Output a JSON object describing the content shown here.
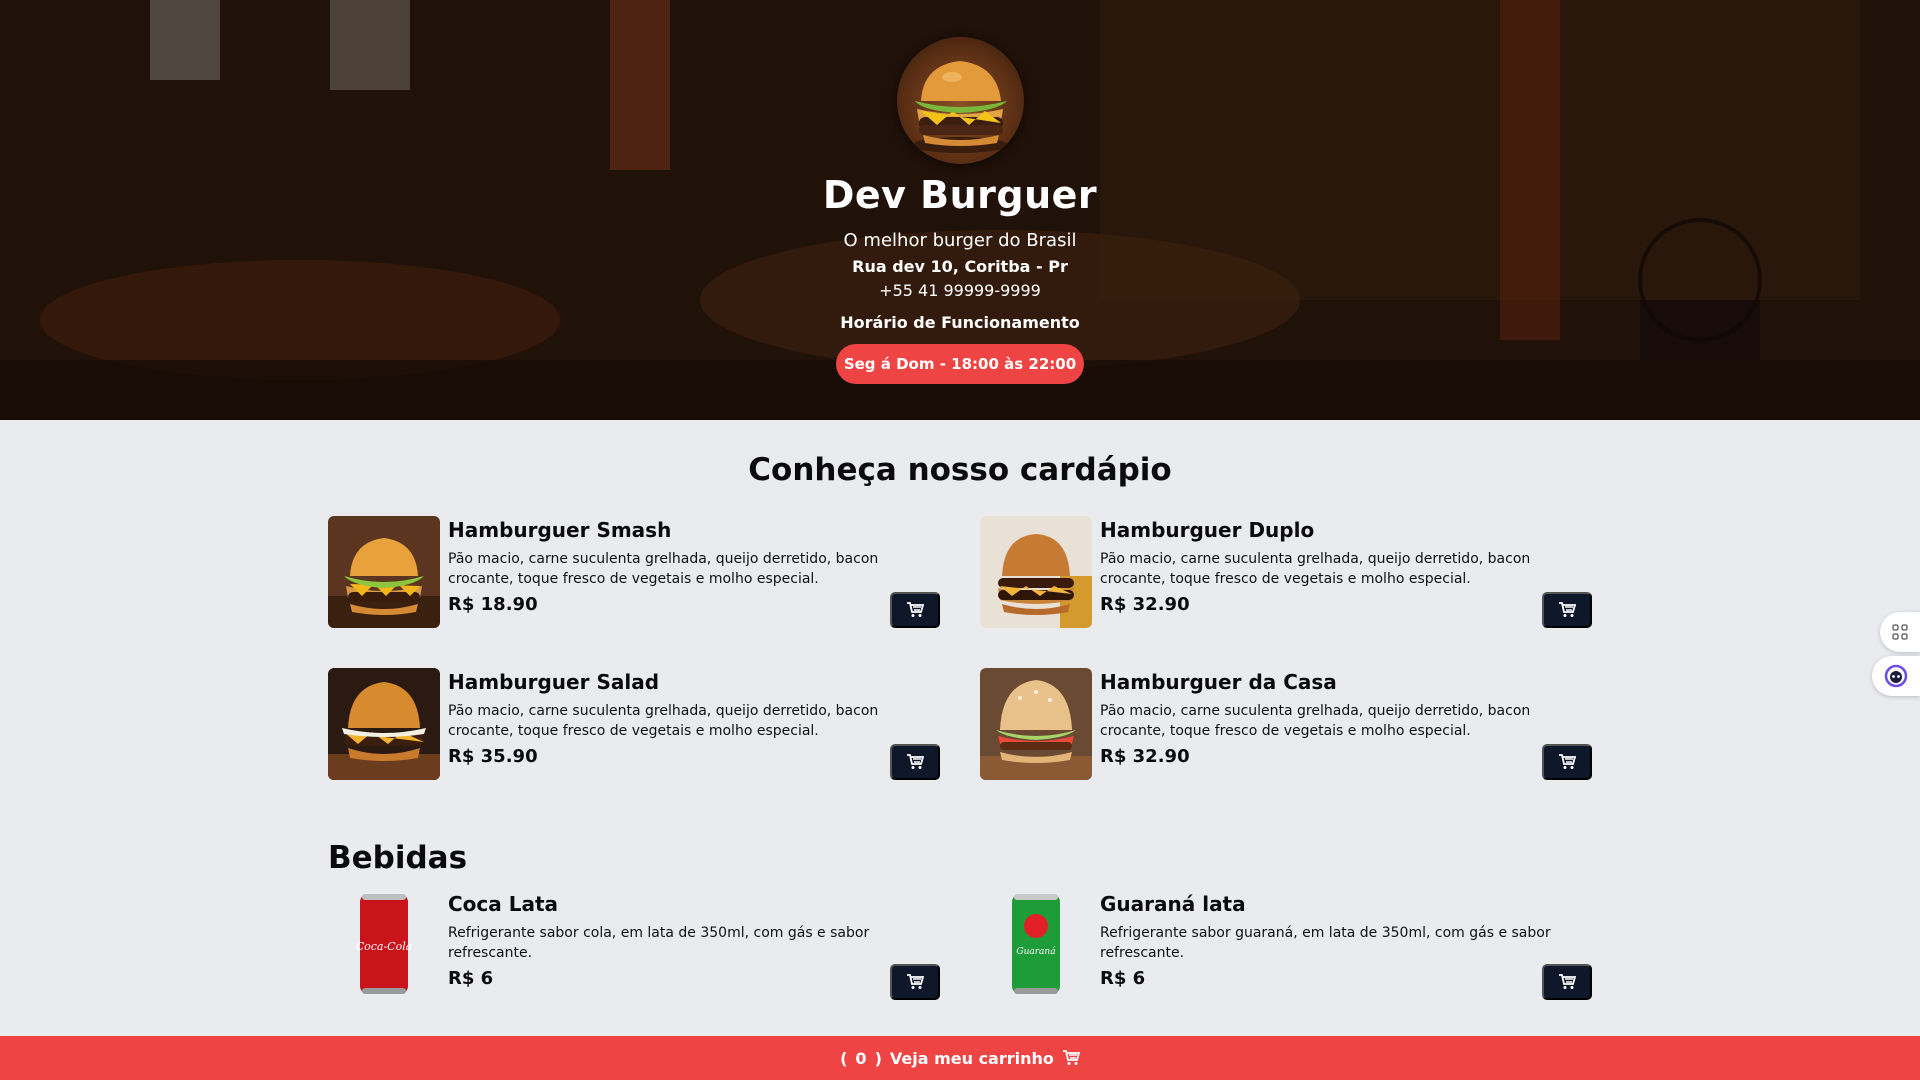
{
  "hero": {
    "title": "Dev Burguer",
    "tagline": "O melhor burger do Brasil",
    "address": "Rua dev 10, Coritba - Pr",
    "phone": "+55 41 99999-9999",
    "hours_title": "Horário de Funcionamento",
    "hours": "Seg á Dom - 18:00 às 22:00"
  },
  "menu": {
    "title": "Conheça nosso cardápio",
    "items": [
      {
        "name": "Hamburguer Smash",
        "description": "Pão macio, carne suculenta grelhada, queijo derretido, bacon crocante, toque fresco de vegetais e molho especial.",
        "price": "R$ 18.90"
      },
      {
        "name": "Hamburguer Duplo",
        "description": "Pão macio, carne suculenta grelhada, queijo derretido, bacon crocante, toque fresco de vegetais e molho especial.",
        "price": "R$ 32.90"
      },
      {
        "name": "Hamburguer Salad",
        "description": "Pão macio, carne suculenta grelhada, queijo derretido, bacon crocante, toque fresco de vegetais e molho especial.",
        "price": "R$ 35.90"
      },
      {
        "name": "Hamburguer da Casa",
        "description": "Pão macio, carne suculenta grelhada, queijo derretido, bacon crocante, toque fresco de vegetais e molho especial.",
        "price": "R$ 32.90"
      }
    ]
  },
  "drinks": {
    "title": "Bebidas",
    "items": [
      {
        "name": "Coca Lata",
        "description": "Refrigerante sabor cola, em lata de 350ml, com gás e sabor refrescante.",
        "price": "R$ 6",
        "can_label": "Coca-Cola"
      },
      {
        "name": "Guaraná lata",
        "description": "Refrigerante sabor guaraná, em lata de 350ml, com gás e sabor refrescante.",
        "price": "R$ 6",
        "can_label": "Guaraná"
      }
    ]
  },
  "footer": {
    "open_paren": "(",
    "count": "0",
    "close_paren": ")",
    "label": "Veja meu carrinho"
  },
  "icons": {
    "cart": "cart-icon",
    "apps": "apps-icon",
    "assistant": "assistant-icon"
  },
  "colors": {
    "accent": "#ef4444",
    "button": "#0f172a",
    "background": "#e9ebef"
  }
}
